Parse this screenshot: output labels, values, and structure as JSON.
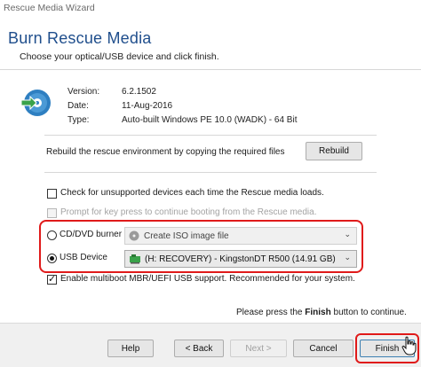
{
  "window": {
    "title": "Rescue Media Wizard"
  },
  "header": {
    "title": "Burn Rescue Media",
    "subtitle": "Choose your optical/USB device and click finish."
  },
  "info": {
    "version_label": "Version:",
    "version_value": "6.2.1502",
    "date_label": "Date:",
    "date_value": "11-Aug-2016",
    "type_label": "Type:",
    "type_value": "Auto-built Windows PE 10.0 (WADK) - 64 Bit"
  },
  "rebuild": {
    "text": "Rebuild the rescue environment by copying the required files",
    "button_label": "Rebuild"
  },
  "options": {
    "check_unsupported": {
      "label": "Check for unsupported devices each time the Rescue media loads.",
      "checked": false
    },
    "prompt_key": {
      "label": "Prompt for key press to continue booting from the Rescue media.",
      "checked": false,
      "disabled": true
    },
    "multiboot": {
      "label": "Enable multiboot MBR/UEFI USB support. Recommended for your system.",
      "checked": true
    }
  },
  "devices": {
    "cd_label": "CD/DVD burner",
    "cd_selected": "Create ISO image file",
    "usb_label": "USB Device",
    "usb_selected": "(H: RECOVERY) - KingstonDT R500 (14.91 GB)",
    "selected_device": "usb"
  },
  "footer": {
    "hint_prefix": "Please press the",
    "hint_bold": "Finish",
    "hint_suffix": "button to continue.",
    "help": "Help",
    "back": "< Back",
    "next": "Next >",
    "cancel": "Cancel",
    "finish": "Finish"
  },
  "colors": {
    "heading": "#1f4e8c",
    "highlight": "#e01a1a",
    "icon_blue": "#2e7fc1",
    "icon_green": "#3aa24a"
  }
}
